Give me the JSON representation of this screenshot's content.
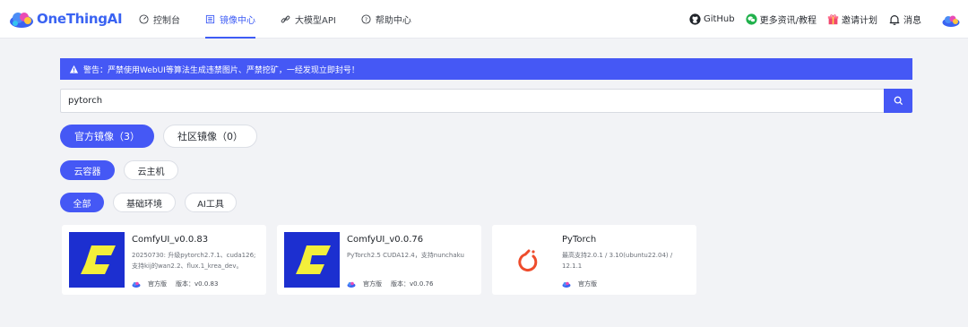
{
  "brand": {
    "name": "OneThingAI",
    "accent": "#4558f5"
  },
  "nav": [
    {
      "label": "控制台",
      "icon": "dashboard-icon",
      "active": false
    },
    {
      "label": "镜像中心",
      "icon": "image-list-icon",
      "active": true
    },
    {
      "label": "大模型API",
      "icon": "link-icon",
      "active": false
    },
    {
      "label": "帮助中心",
      "icon": "help-icon",
      "active": false
    }
  ],
  "right_nav": {
    "github": "GitHub",
    "more_info": "更多资讯/教程",
    "invite": "邀请计划",
    "messages": "消息"
  },
  "warning": {
    "text": "警告：严禁使用WebUI等算法生成违禁图片、严禁挖矿，一经发现立即封号！"
  },
  "search": {
    "value": "pytorch",
    "placeholder": ""
  },
  "source_tabs": [
    {
      "label": "官方镜像（3）",
      "active": true
    },
    {
      "label": "社区镜像（0）",
      "active": false
    }
  ],
  "type_tabs": [
    {
      "label": "云容器",
      "active": true
    },
    {
      "label": "云主机",
      "active": false
    }
  ],
  "category_tabs": [
    {
      "label": "全部",
      "active": true
    },
    {
      "label": "基础环境",
      "active": false
    },
    {
      "label": "AI工具",
      "active": false
    }
  ],
  "cards": [
    {
      "title": "ComfyUI_v0.0.83",
      "desc": "20250730: 升级pytorch2.7.1、cuda126; 支持kij的wan2.2、flux.1_krea_dev。",
      "badge": "官方版",
      "version": "版本：v0.0.83",
      "icon": "comfyui-logo-icon"
    },
    {
      "title": "ComfyUI_v0.0.76",
      "desc": "PyTorch2.5 CUDA12.4，支持nunchaku",
      "badge": "官方版",
      "version": "版本：v0.0.76",
      "icon": "comfyui-logo-icon"
    },
    {
      "title": "PyTorch",
      "desc": "最高支持2.0.1 / 3.10(ubuntu22.04) / 12.1.1",
      "badge": "官方版",
      "version": "",
      "icon": "pytorch-logo-icon"
    }
  ]
}
